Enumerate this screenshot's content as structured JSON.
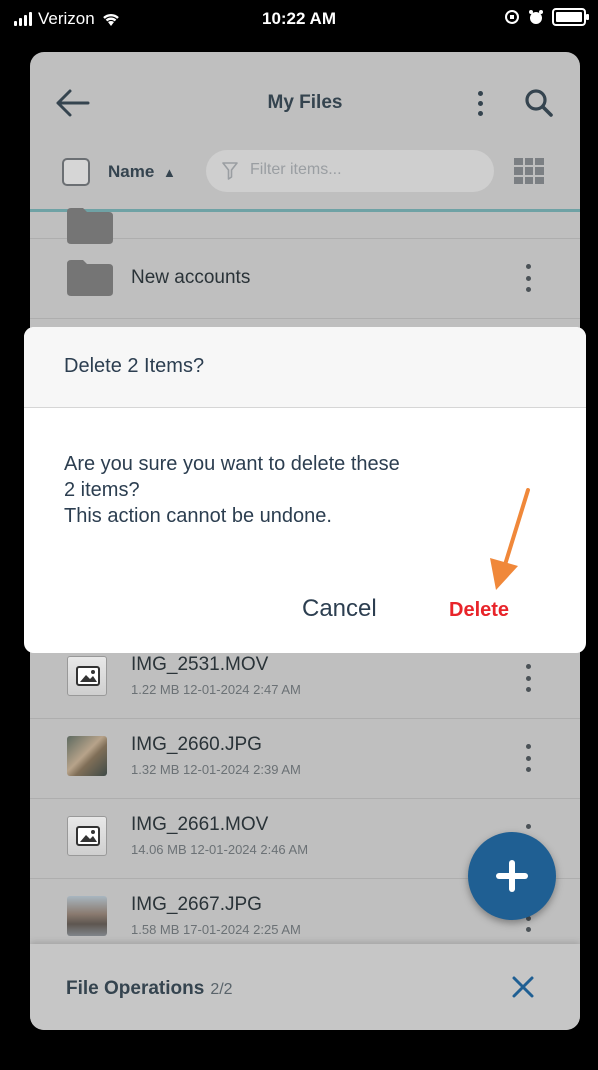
{
  "status_bar": {
    "carrier": "Verizon",
    "time": "10:22 AM"
  },
  "header": {
    "title": "My Files",
    "back_icon": "arrow-left-icon",
    "more_icon": "kebab-icon",
    "search_icon": "search-icon"
  },
  "toolbar": {
    "sort_label": "Name",
    "sort_direction": "▲",
    "filter_placeholder": "Filter items..."
  },
  "list": {
    "folders": [
      {
        "name": "New accounts",
        "icon": "folder-icon"
      }
    ],
    "files": [
      {
        "name": "IMG_2531.MOV",
        "meta": "1.22 MB 12-01-2024 2:47 AM",
        "thumb": "mov"
      },
      {
        "name": "IMG_2660.JPG",
        "meta": "1.32 MB 12-01-2024 2:39 AM",
        "thumb": "jpg1"
      },
      {
        "name": "IMG_2661.MOV",
        "meta": "14.06 MB 12-01-2024 2:46 AM",
        "thumb": "mov"
      },
      {
        "name": "IMG_2667.JPG",
        "meta": "1.58 MB 17-01-2024 2:25 AM",
        "thumb": "jpg2"
      }
    ]
  },
  "dialog": {
    "title": "Delete 2 Items?",
    "message": "Are you sure you want to delete these\n2 items?\nThis action cannot be undone.",
    "cancel_label": "Cancel",
    "delete_label": "Delete"
  },
  "bottom_bar": {
    "label": "File Operations",
    "count": "2/2"
  },
  "colors": {
    "accent": "#1f5f93",
    "danger": "#e8242a",
    "annotation_arrow": "#f0883a"
  }
}
